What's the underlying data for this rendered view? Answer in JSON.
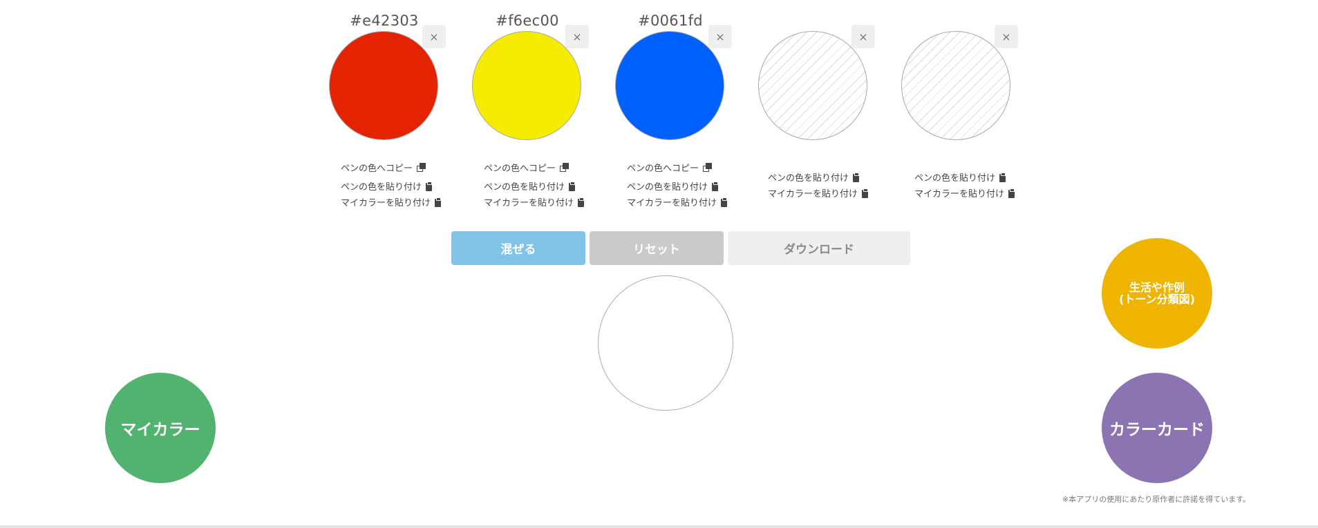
{
  "slots": [
    {
      "hex": "#e42303",
      "color": "#e42303",
      "copy": "ペンの色へコピー",
      "paste_pen": "ペンの色を貼り付け",
      "paste_my": "マイカラーを貼り付け"
    },
    {
      "hex": "#f6ec00",
      "color": "#f6ec00",
      "copy": "ペンの色へコピー",
      "paste_pen": "ペンの色を貼り付け",
      "paste_my": "マイカラーを貼り付け"
    },
    {
      "hex": "#0061fd",
      "color": "#0061fd",
      "copy": "ペンの色へコピー",
      "paste_pen": "ペンの色を貼り付け",
      "paste_my": "マイカラーを貼り付け"
    },
    {
      "hex": "",
      "color": "",
      "paste_pen": "ペンの色を貼り付け",
      "paste_my": "マイカラーを貼り付け"
    },
    {
      "hex": "",
      "color": "",
      "paste_pen": "ペンの色を貼り付け",
      "paste_my": "マイカラーを貼り付け"
    }
  ],
  "close_label": "×",
  "buttons": {
    "mix": "混ぜる",
    "reset": "リセット",
    "download": "ダウンロード"
  },
  "side_buttons": {
    "mycolor": "マイカラー",
    "life_line1": "生活や作例",
    "life_line2": "(トーン分類図)",
    "colorcard": "カラーカード"
  },
  "footnote": "※本アプリの使用にあたり原作者に許諾を得ています。",
  "icons": {
    "copy": "copy-icon",
    "paste": "clipboard-icon",
    "close": "close-icon"
  },
  "colors": {
    "mix_button": "#80c3e6",
    "reset_button": "#cacaca",
    "mycolor_button": "#52b26f",
    "life_button": "#efb400",
    "colorcard_button": "#8c74b2"
  }
}
